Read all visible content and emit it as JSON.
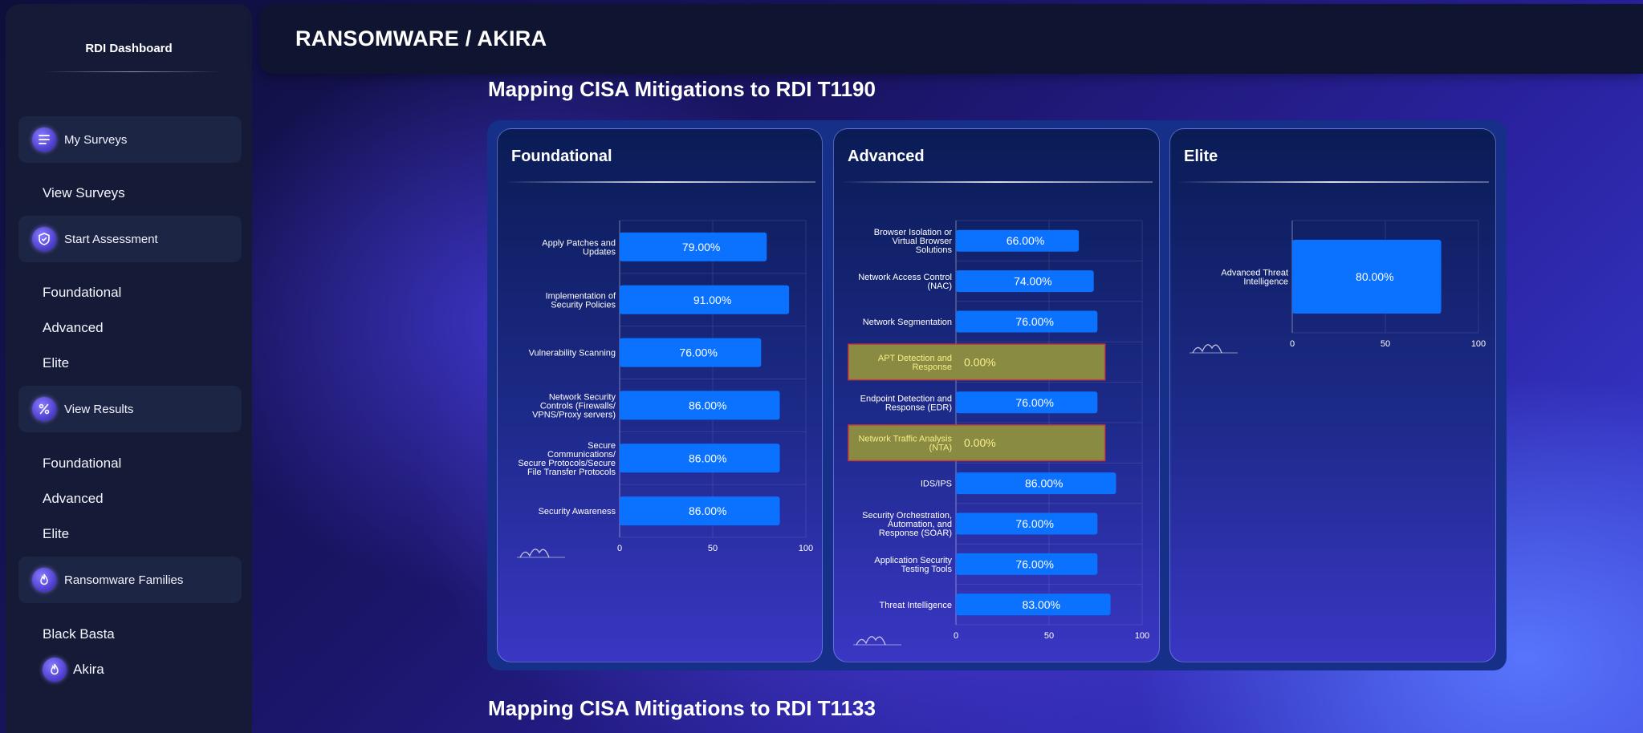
{
  "sidebar": {
    "brand": "RDI Dashboard",
    "groups": [
      {
        "label": "My Surveys",
        "icon": "survey-list-icon",
        "children": [
          "View Surveys"
        ]
      },
      {
        "label": "Start Assessment",
        "icon": "shield-icon",
        "children": [
          "Foundational",
          "Advanced",
          "Elite"
        ]
      },
      {
        "label": "View Results",
        "icon": "results-percent-icon",
        "children": [
          "Foundational",
          "Advanced",
          "Elite"
        ]
      },
      {
        "label": "Ransomware Families",
        "icon": "flame-icon",
        "children": [
          "Black Basta",
          "Akira"
        ]
      }
    ],
    "active_child": "Akira"
  },
  "header": {
    "title": "RANSOMWARE / AKIRA"
  },
  "sections": [
    {
      "title": "Mapping CISA Mitigations to RDI T1190"
    },
    {
      "title": "Mapping CISA Mitigations to RDI T1133"
    }
  ],
  "colors": {
    "bar": "#0a72ff",
    "warn_fill": "#8a8b42",
    "warn_border": "#c93a3a",
    "warn_text": "#f4ee85"
  },
  "chart_data": [
    {
      "type": "bar",
      "orientation": "horizontal",
      "title": "Foundational",
      "xlim": [
        0,
        100
      ],
      "xticks": [
        "0",
        "50",
        "100"
      ],
      "categories": [
        [
          "Apply Patches and",
          "Updates"
        ],
        [
          "Implementation of",
          "Security Policies"
        ],
        [
          "Vulnerability Scanning"
        ],
        [
          "Network Security",
          "Controls (Firewalls/",
          "VPNS/Proxy servers)"
        ],
        [
          "Secure",
          "Communications/",
          "Secure Protocols/Secure",
          "File Transfer Protocols"
        ],
        [
          "Security Awareness"
        ]
      ],
      "values": [
        79,
        91,
        76,
        86,
        86,
        86
      ],
      "value_labels": [
        "79.00%",
        "91.00%",
        "76.00%",
        "86.00%",
        "86.00%",
        "86.00%"
      ],
      "highlight": [
        false,
        false,
        false,
        false,
        false,
        false
      ]
    },
    {
      "type": "bar",
      "orientation": "horizontal",
      "title": "Advanced",
      "xlim": [
        0,
        100
      ],
      "xticks": [
        "0",
        "50",
        "100"
      ],
      "categories": [
        [
          "Browser Isolation or",
          "Virtual Browser",
          "Solutions"
        ],
        [
          "Network Access Control",
          "(NAC)"
        ],
        [
          "Network Segmentation"
        ],
        [
          "APT Detection and",
          "Response"
        ],
        [
          "Endpoint Detection and",
          "Response (EDR)"
        ],
        [
          "Network Traffic Analysis",
          "(NTA)"
        ],
        [
          "IDS/IPS"
        ],
        [
          "Security Orchestration,",
          "Automation, and",
          "Response (SOAR)"
        ],
        [
          "Application Security",
          "Testing Tools"
        ],
        [
          "Threat Intelligence"
        ]
      ],
      "values": [
        66,
        74,
        76,
        0,
        76,
        0,
        86,
        76,
        76,
        83
      ],
      "value_labels": [
        "66.00%",
        "74.00%",
        "76.00%",
        "0.00%",
        "76.00%",
        "0.00%",
        "86.00%",
        "76.00%",
        "76.00%",
        "83.00%"
      ],
      "highlight": [
        false,
        false,
        false,
        true,
        false,
        true,
        false,
        false,
        false,
        false
      ]
    },
    {
      "type": "bar",
      "orientation": "horizontal",
      "title": "Elite",
      "xlim": [
        0,
        100
      ],
      "xticks": [
        "0",
        "50",
        "100"
      ],
      "categories": [
        [
          "Advanced Threat",
          "Intelligence"
        ]
      ],
      "values": [
        80
      ],
      "value_labels": [
        "80.00%"
      ],
      "highlight": [
        false
      ]
    }
  ]
}
